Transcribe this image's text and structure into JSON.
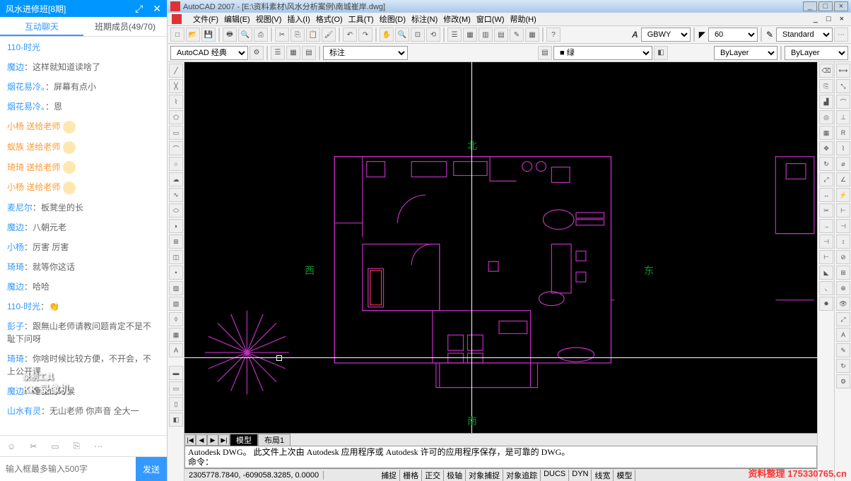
{
  "chat": {
    "title": "风水进修班[8期]",
    "tabs": {
      "active": "互动聊天",
      "members": "班期成员(49/70)"
    },
    "messages": [
      {
        "name": "110-时光",
        "nc": "name",
        "text": "",
        "emoji": false,
        "truncated": true
      },
      {
        "name": "魔边",
        "nc": "name",
        "text": "：这样就知道读啥了",
        "emoji": false
      },
      {
        "name": "烟花易冷。",
        "nc": "name",
        "text": "：屏幕有点小",
        "emoji": false
      },
      {
        "name": "烟花易冷。",
        "nc": "name",
        "text": "：恩",
        "emoji": false
      },
      {
        "name": "小杨 送给老师",
        "nc": "name orange",
        "text": "",
        "emoji": true
      },
      {
        "name": "蚁族 送给老师",
        "nc": "name orange",
        "text": "",
        "emoji": true
      },
      {
        "name": "琦琦 送给老师",
        "nc": "name orange",
        "text": "",
        "emoji": true
      },
      {
        "name": "小杨 送给老师",
        "nc": "name orange",
        "text": "",
        "emoji": true
      },
      {
        "name": "麦尼尔",
        "nc": "name",
        "text": "：板凳坐的长",
        "emoji": false
      },
      {
        "name": "魔边",
        "nc": "name",
        "text": "：八朝元老",
        "emoji": false
      },
      {
        "name": "小杨",
        "nc": "name",
        "text": "：厉害 厉害",
        "emoji": false
      },
      {
        "name": "琦琦",
        "nc": "name",
        "text": "：就等你这话",
        "emoji": false
      },
      {
        "name": "魔边",
        "nc": "name",
        "text": "：哈哈",
        "emoji": false
      },
      {
        "name": "110-时光",
        "nc": "name",
        "text": "：👏",
        "emoji": false
      },
      {
        "name": "彭子",
        "nc": "name",
        "text": "：跟無山老师请教问题肯定不是不耻下问呀",
        "emoji": false
      },
      {
        "name": "琦琦",
        "nc": "name",
        "text": "：你啥时候比较方便，不开会，不上公开课",
        "emoji": false
      },
      {
        "name": "魔边",
        "nc": "name",
        "text": "：睡觉的时候",
        "emoji": false
      },
      {
        "name": "山水有灵",
        "nc": "name",
        "text": "：无山老师 你声音  全大一",
        "emoji": false
      }
    ],
    "input_placeholder": "输入框最多输入500字",
    "send": "发送",
    "kk": {
      "top": "录制工具",
      "bottom": "KK 录像机"
    }
  },
  "acad": {
    "title": "AutoCAD 2007 - [E:\\资料素材\\风水分析案例\\南城崔岸.dwg]",
    "menu": [
      "文件(F)",
      "编辑(E)",
      "视图(V)",
      "插入(I)",
      "格式(O)",
      "工具(T)",
      "绘图(D)",
      "标注(N)",
      "修改(M)",
      "窗口(W)",
      "帮助(H)"
    ],
    "tb": {
      "workspace": "AutoCAD 经典",
      "annotation": "标注",
      "layer": "■ 绿",
      "bylayer": "ByLayer",
      "bylayer2": "ByLayer",
      "font": "GBWY",
      "lineweight": "60",
      "textstyle": "Standard"
    },
    "directions": {
      "n": "北",
      "s": "南",
      "e": "东",
      "w": "西"
    },
    "tabs": {
      "model": "模型",
      "layout1": "布局1"
    },
    "cmd": {
      "line1": "Autodesk DWG。  此文件上次由 Autodesk 应用程序或 Autodesk 许可的应用程序保存，是可靠的 DWG。",
      "line2": "命令："
    },
    "status": {
      "coords": "2305778.7840, -609058.3285, 0.0000",
      "buttons": [
        "捕捉",
        "栅格",
        "正交",
        "极轴",
        "对象捕捉",
        "对象追踪",
        "DUCS",
        "DYN",
        "线宽",
        "模型"
      ]
    },
    "watermark": "资料整理 175330765.cn"
  }
}
